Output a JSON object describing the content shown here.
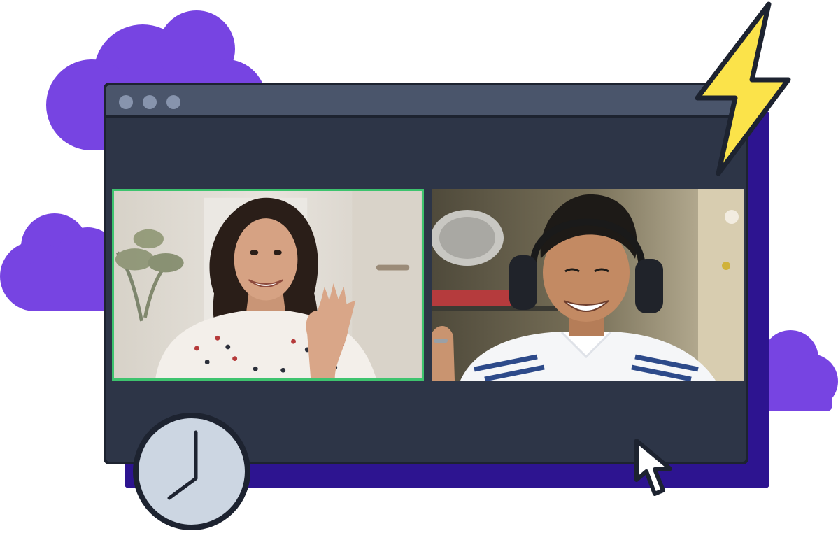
{
  "illustration": {
    "window_controls": [
      "window-dot-1",
      "window-dot-2",
      "window-dot-3"
    ],
    "participants": [
      {
        "id": "participant-1",
        "active_speaker": true,
        "highlight_color": "#3ec36e"
      },
      {
        "id": "participant-2",
        "active_speaker": false
      }
    ],
    "decorations": [
      "cloud-icon",
      "lightning-bolt-icon",
      "clock-icon",
      "mouse-pointer-icon"
    ],
    "colors": {
      "cloud": "#7744e2",
      "window_shadow": "#2d1490",
      "window_body": "#2d3547",
      "titlebar": "#4a556b",
      "bolt": "#fbe34a",
      "clock_face": "#ccd6e2"
    }
  }
}
